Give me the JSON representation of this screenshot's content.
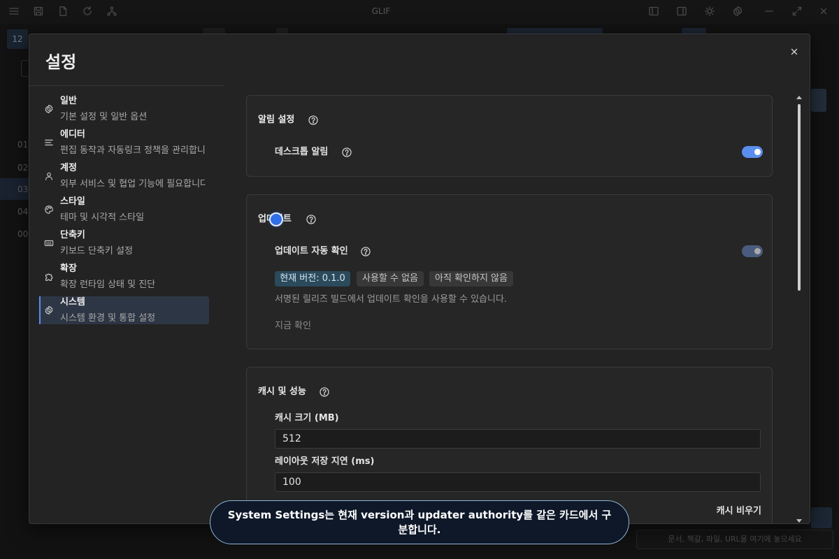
{
  "app": {
    "title": "GLIF",
    "sidebar_badge": "12",
    "sidebar_rows": [
      "01",
      "02",
      "03",
      "04",
      "00"
    ],
    "drop_placeholder": "문서, 책갈, 파일, URL을 여기에 놓으세요"
  },
  "settings": {
    "title": "설정",
    "nav": [
      {
        "icon": "gear-icon",
        "title": "일반",
        "subtitle": "기본 설정 및 일반 옵션"
      },
      {
        "icon": "lines-icon",
        "title": "에디터",
        "subtitle": "편집 동작과 자동링크 정책을 관리합니"
      },
      {
        "icon": "user-icon",
        "title": "계정",
        "subtitle": "외부 서비스 및 협업 기능에 필요합니다"
      },
      {
        "icon": "palette-icon",
        "title": "스타일",
        "subtitle": "테마 및 시각적 스타일"
      },
      {
        "icon": "keyboard-icon",
        "title": "단축키",
        "subtitle": "키보드 단축키 설정"
      },
      {
        "icon": "puzzle-icon",
        "title": "확장",
        "subtitle": "확장 런타임 상태 및 진단"
      },
      {
        "icon": "gear-icon",
        "title": "시스템",
        "subtitle": "시스템 환경 및 통합 설정",
        "active": true
      }
    ],
    "notifications": {
      "title": "알림 설정",
      "desktop_label": "데스크톱 알림",
      "desktop_enabled": true
    },
    "updates": {
      "title": "업데이트",
      "auto_check_label": "업데이트 자동 확인",
      "auto_check_enabled": true,
      "auto_check_disabled": true,
      "badges": [
        "현재 버전: 0.1.0",
        "사용할 수 없음",
        "아직 확인하지 않음"
      ],
      "note": "서명된 릴리즈 빌드에서 업데이트 확인을 사용할 수 있습니다.",
      "check_now": "지금 확인"
    },
    "cache": {
      "title": "캐시 및 성능",
      "cache_size_label": "캐시 크기 (MB)",
      "cache_size_value": "512",
      "layout_delay_label": "레이아웃 저장 지연 (ms)",
      "layout_delay_value": "100",
      "clear_cache": "캐시 비우기"
    }
  },
  "toast": {
    "text": "System Settings는 현재 version과 updater authority를 같은 카드에서 구분합니다."
  },
  "colors": {
    "accent": "#5b8def",
    "active_nav_bg": "#2d3644",
    "toast_border": "#8fb4d9"
  }
}
